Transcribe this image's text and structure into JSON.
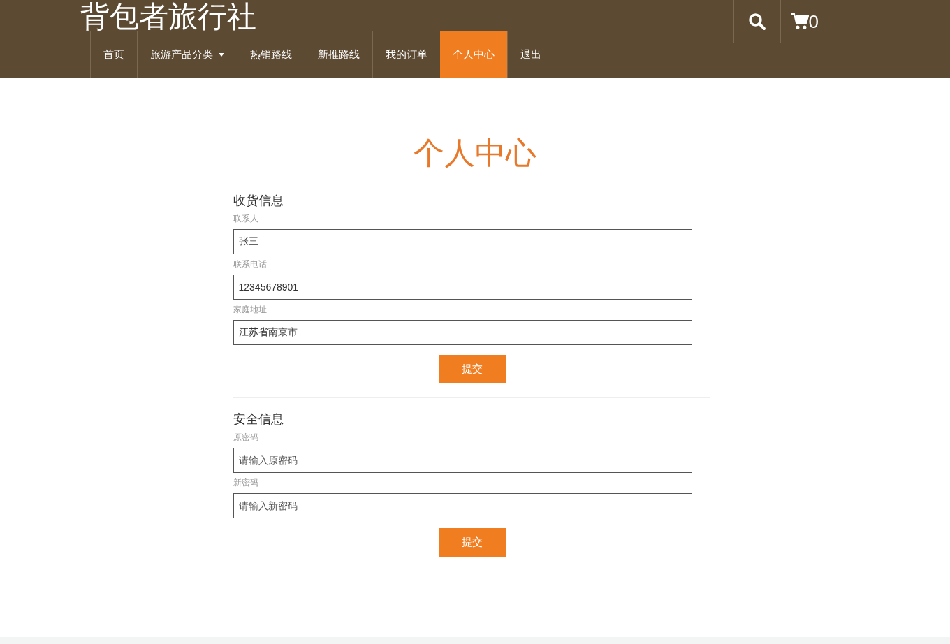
{
  "header": {
    "logo": "背包者旅行社",
    "nav": [
      {
        "label": "首页",
        "selected": false,
        "dropdown": false
      },
      {
        "label": "旅游产品分类",
        "selected": false,
        "dropdown": true
      },
      {
        "label": "热销路线",
        "selected": false,
        "dropdown": false
      },
      {
        "label": "新推路线",
        "selected": false,
        "dropdown": false
      },
      {
        "label": "我的订单",
        "selected": false,
        "dropdown": false
      },
      {
        "label": "个人中心",
        "selected": true,
        "dropdown": false
      },
      {
        "label": "退出",
        "selected": false,
        "dropdown": false
      }
    ],
    "cart_count": "0"
  },
  "page_title": "个人中心",
  "sections": [
    {
      "title": "收货信息",
      "fields": [
        {
          "label": "联系人",
          "value": "张三"
        },
        {
          "label": "联系电话",
          "value": "12345678901"
        },
        {
          "label": "家庭地址",
          "value": "江苏省南京市"
        }
      ],
      "submit": "提交"
    },
    {
      "title": "安全信息",
      "fields": [
        {
          "label": "原密码",
          "placeholder": "请输入原密码"
        },
        {
          "label": "新密码",
          "placeholder": "请输入新密码"
        }
      ],
      "submit": "提交"
    }
  ]
}
